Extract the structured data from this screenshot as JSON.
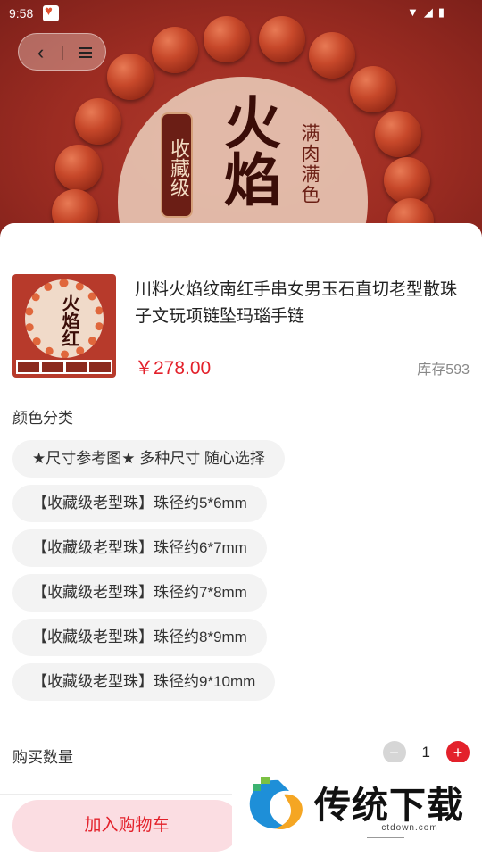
{
  "status_bar": {
    "time": "9:58"
  },
  "hero": {
    "plaque_text": "收藏级",
    "calligraphy": "火焰",
    "vertical_text": "满肉满色"
  },
  "product": {
    "title": "川料火焰纹南红手串女男玉石直切老型散珠子文玩项链坠玛瑙手链",
    "price": "￥278.00",
    "stock": "库存593",
    "thumb_text": "火焰红"
  },
  "options": {
    "label": "颜色分类",
    "items": [
      "★尺寸参考图★ 多种尺寸 随心选择",
      "【收藏级老型珠】珠径约5*6mm",
      "【收藏级老型珠】珠径约6*7mm",
      "【收藏级老型珠】珠径约7*8mm",
      "【收藏级老型珠】珠径约8*9mm",
      "【收藏级老型珠】珠径约9*10mm"
    ]
  },
  "quantity": {
    "label": "购买数量",
    "value": "1",
    "minus": "−",
    "plus": "+"
  },
  "actions": {
    "add_to_cart": "加入购物车"
  },
  "watermark": {
    "brand": "传统下载",
    "domain": "ctdown.com"
  },
  "colors": {
    "accent": "#e3212b",
    "cart_bg": "#fbdde2",
    "chip_bg": "#f3f3f3"
  },
  "icons": {
    "back": "chevron-left-icon",
    "menu": "menu-icon"
  }
}
